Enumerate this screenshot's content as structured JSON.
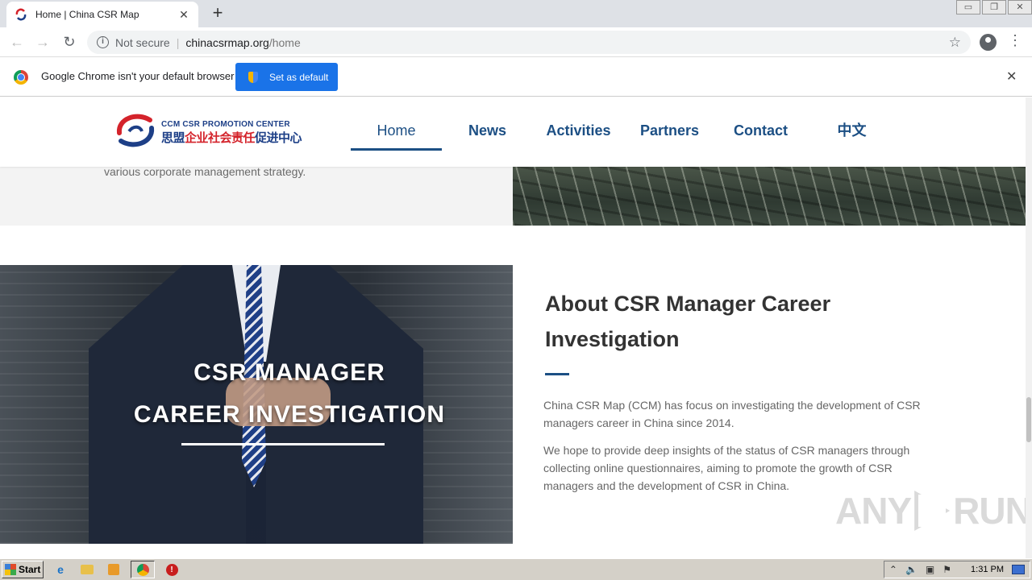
{
  "browser": {
    "tab_title": "Home | China CSR Map",
    "tab_close": "✕",
    "new_tab": "+",
    "window_controls": [
      "▭",
      "❐",
      "✕"
    ],
    "nav": {
      "back": "←",
      "forward": "→",
      "reload": "↻"
    },
    "address": {
      "info": "i",
      "security": "Not secure",
      "separator": "|",
      "host": "chinacsrmap.org",
      "path": "/home",
      "bookmark": "☆"
    },
    "menu": "⋮"
  },
  "infobar": {
    "message": "Google Chrome isn't your default browser",
    "button": "Set as default",
    "close": "✕"
  },
  "site": {
    "logo": {
      "en_prefix": "CCM ",
      "en_csr": "CSR",
      "en_suffix": " PROMOTION CENTER",
      "cn_part1": "思盟",
      "cn_part2": "企业社会责任",
      "cn_part3": "促进中心"
    },
    "nav": [
      {
        "label": "Home"
      },
      {
        "label": "News"
      },
      {
        "label": "Activities"
      },
      {
        "label": "Partners"
      },
      {
        "label": "Contact"
      },
      {
        "label": "中文"
      }
    ],
    "top_text": "various corporate management strategy.",
    "hero": {
      "line1": "CSR MANAGER",
      "line2": "CAREER INVESTIGATION"
    },
    "about": {
      "title": "About CSR Manager Career Investigation",
      "p1": "China CSR Map (CCM) has focus on investigating the development of CSR managers career in China since 2014.",
      "p2": "We hope  to provide deep insights of the status of CSR managers through collecting online questionnaires, aiming to promote the growth of CSR managers and the development of CSR in China."
    },
    "watermark": {
      "left": "ANY",
      "right": "RUN"
    }
  },
  "taskbar": {
    "start": "Start",
    "ie": "e",
    "stop": "!",
    "tray_icons": [
      "⌃",
      "🔈",
      "▣",
      "⚑"
    ],
    "clock": "1:31 PM"
  }
}
